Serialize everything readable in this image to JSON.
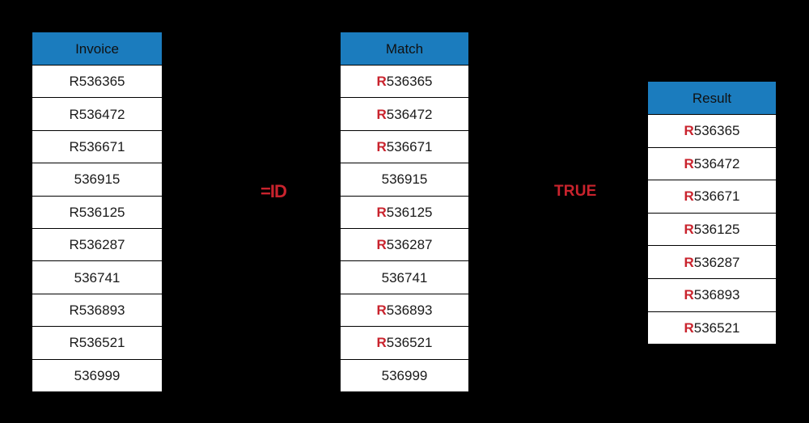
{
  "background_color": "#000000",
  "theme": {
    "header_blue": "#1B7CBE",
    "cell_white": "#FFFFFF",
    "accent_red": "#C9232D",
    "text_black": "#1A1A1A"
  },
  "tables": {
    "invoice": {
      "header": "Invoice",
      "rows": [
        {
          "prefix": "",
          "number": "R536365"
        },
        {
          "prefix": "",
          "number": "R536472"
        },
        {
          "prefix": "",
          "number": "R536671"
        },
        {
          "prefix": "",
          "number": "536915"
        },
        {
          "prefix": "",
          "number": "R536125"
        },
        {
          "prefix": "",
          "number": "R536287"
        },
        {
          "prefix": "",
          "number": "536741"
        },
        {
          "prefix": "",
          "number": "R536893"
        },
        {
          "prefix": "",
          "number": "R536521"
        },
        {
          "prefix": "",
          "number": "536999"
        }
      ]
    },
    "match": {
      "header": "Match",
      "rows": [
        {
          "prefix": "R",
          "number": "536365"
        },
        {
          "prefix": "R",
          "number": "536472"
        },
        {
          "prefix": "R",
          "number": "536671"
        },
        {
          "prefix": "",
          "number": "536915"
        },
        {
          "prefix": "R",
          "number": "536125"
        },
        {
          "prefix": "R",
          "number": "536287"
        },
        {
          "prefix": "",
          "number": "536741"
        },
        {
          "prefix": "R",
          "number": "536893"
        },
        {
          "prefix": "R",
          "number": "536521"
        },
        {
          "prefix": "",
          "number": "536999"
        }
      ]
    },
    "result": {
      "header": "Result",
      "rows": [
        {
          "prefix": "R",
          "number": "536365"
        },
        {
          "prefix": "R",
          "number": "536472"
        },
        {
          "prefix": "R",
          "number": "536671"
        },
        {
          "prefix": "R",
          "number": "536125"
        },
        {
          "prefix": "R",
          "number": "536287"
        },
        {
          "prefix": "R",
          "number": "536893"
        },
        {
          "prefix": "R",
          "number": "536521"
        }
      ]
    }
  },
  "annotations": {
    "formula": "=ID",
    "truth_value": "TRUE"
  }
}
